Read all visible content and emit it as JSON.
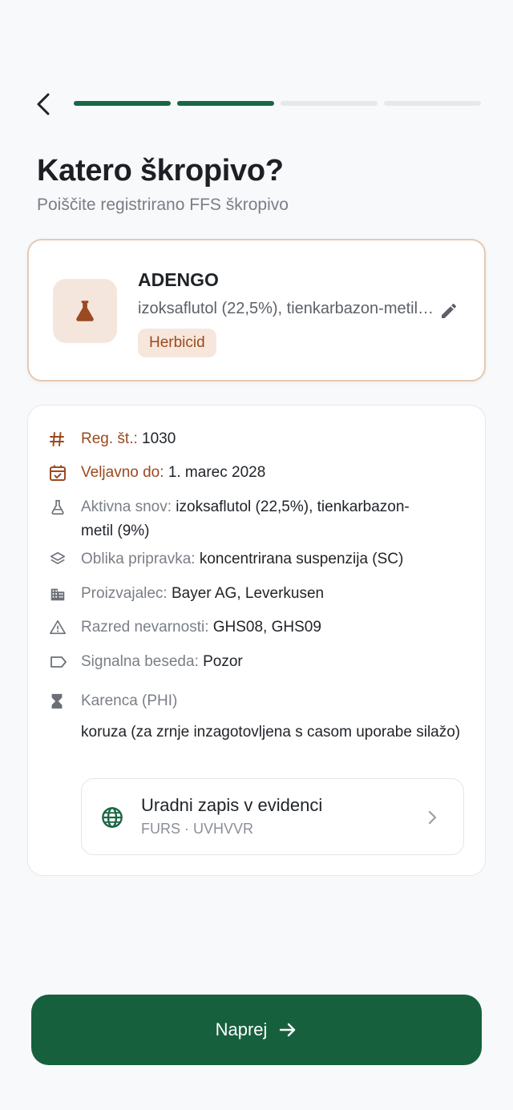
{
  "header": {
    "progress": {
      "total_steps": 4,
      "completed_steps": 2
    }
  },
  "page": {
    "title": "Katero škropivo?",
    "subtitle": "Poiščite registrirano FFS škropivo"
  },
  "product": {
    "icon": "flask-icon",
    "name": "ADENGO",
    "active_substance": "izoksaflutol (22,5%), tienkarbazon-metil (9%)",
    "category": "Herbicid",
    "accent_color": "#9a4a1f"
  },
  "details": {
    "reg_no": {
      "label": "Reg. št.:",
      "value": "1030"
    },
    "valid_until": {
      "label": "Veljavno do:",
      "value": "1. marec 2028"
    },
    "active": {
      "label": "Aktivna snov:",
      "value": "izoksaflutol (22,5%), tienkarbazon-",
      "value_cont": "metil (9%)"
    },
    "formulation": {
      "label": "Oblika pripravka:",
      "value": "koncentrirana suspenzija (SC)"
    },
    "manufacturer": {
      "label": "Proizvajalec:",
      "value": "Bayer AG, Leverkusen"
    },
    "hazard_class": {
      "label": "Razred nevarnosti:",
      "value": "GHS08, GHS09"
    },
    "signal_word": {
      "label": "Signalna beseda:",
      "value": "Pozor"
    },
    "phi": {
      "label": "Karenca (PHI)",
      "value": "koruza (za zrnje inzagotovljena s casom uporabe silažo)"
    }
  },
  "registry": {
    "title": "Uradni zapis v evidenci",
    "subtitle": "FURS · UVHVVR"
  },
  "footer": {
    "next_label": "Naprej",
    "primary_color": "#17603e"
  }
}
